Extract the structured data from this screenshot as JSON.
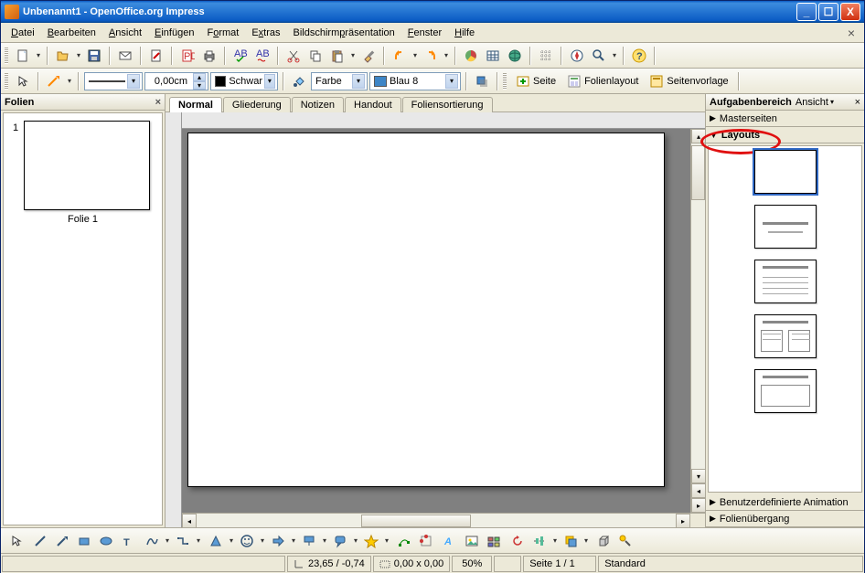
{
  "window": {
    "title": "Unbenannt1 - OpenOffice.org Impress"
  },
  "menu": {
    "file": "Datei",
    "edit": "Bearbeiten",
    "view": "Ansicht",
    "insert": "Einfügen",
    "format": "Format",
    "extras": "Extras",
    "slideshow": "Bildschirmpräsentation",
    "window": "Fenster",
    "help": "Hilfe"
  },
  "toolbar2": {
    "linewidth": "0,00cm",
    "linecolor_label": "Schwarz",
    "fillmode": "Farbe",
    "fillcolor_label": "Blau 8",
    "btn_slide": "Seite",
    "btn_layout": "Folienlayout",
    "btn_master": "Seitenvorlage"
  },
  "slidesPane": {
    "title": "Folien",
    "slide1_label": "Folie 1",
    "slide1_num": "1"
  },
  "viewtabs": {
    "normal": "Normal",
    "outline": "Gliederung",
    "notes": "Notizen",
    "handout": "Handout",
    "sorter": "Foliensortierung"
  },
  "tasksPane": {
    "title": "Aufgabenbereich",
    "subtitle": "Ansicht",
    "sec_master": "Masterseiten",
    "sec_layouts": "Layouts",
    "sec_anim": "Benutzerdefinierte Animation",
    "sec_trans": "Folienübergang"
  },
  "status": {
    "coords": "23,65 / -0,74",
    "size": "0,00 x 0,00",
    "zoom": "50%",
    "page": "Seite 1 / 1",
    "mode": "Standard"
  },
  "colors": {
    "black": "#000000",
    "blue8": "#3d85c6"
  }
}
